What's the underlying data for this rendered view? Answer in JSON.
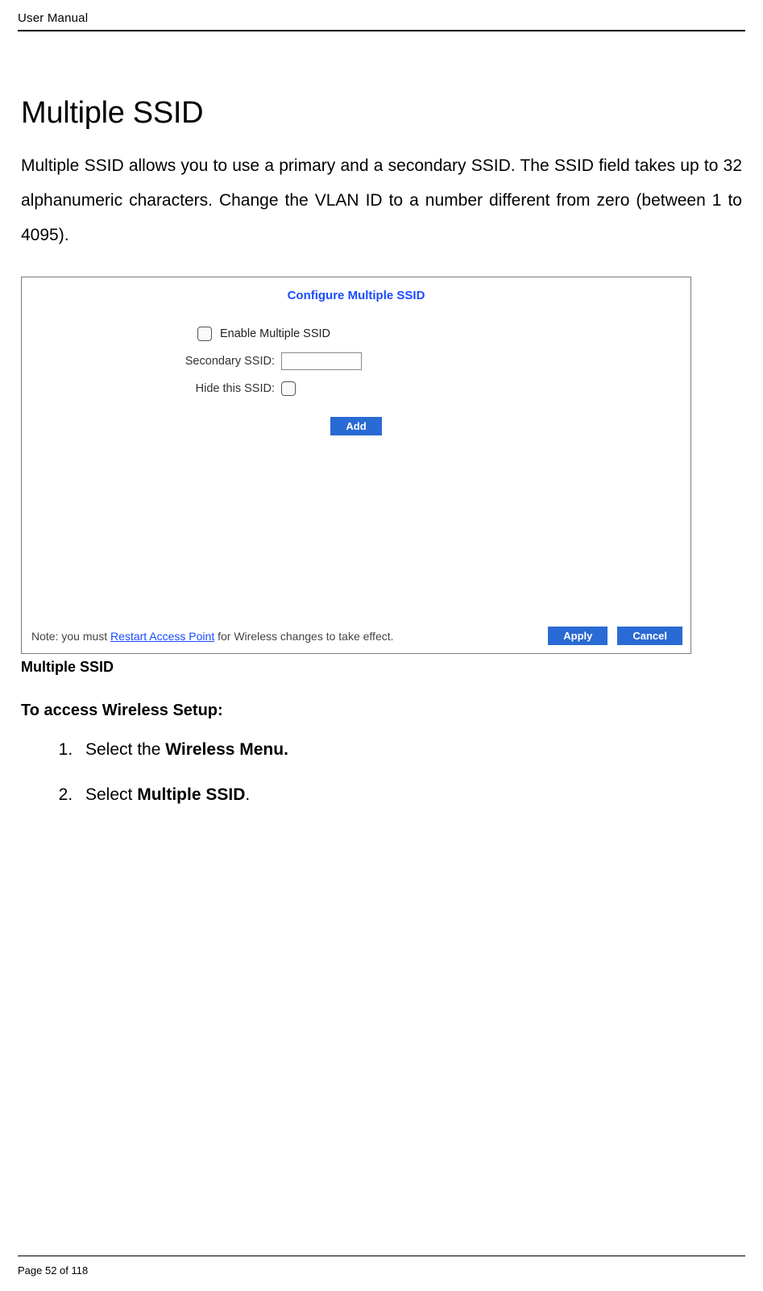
{
  "header": {
    "title": "User Manual"
  },
  "section": {
    "title": "Multiple SSID",
    "body": "Multiple SSID allows you to use a primary and a secondary SSID. The SSID field takes up to 32 alphanumeric characters. Change the VLAN ID to a number different from zero (between 1 to 4095)."
  },
  "screenshot": {
    "title": "Configure Multiple SSID",
    "enable_label": "Enable Multiple SSID",
    "secondary_label": "Secondary SSID:",
    "secondary_value": "",
    "hide_label": "Hide this SSID:",
    "add_label": "Add",
    "note_prefix": "Note: you must ",
    "note_link": "Restart Access Point",
    "note_suffix": " for Wireless changes to take effect.",
    "apply_label": "Apply",
    "cancel_label": "Cancel"
  },
  "caption": "Multiple SSID",
  "subheading": "To access Wireless Setup:",
  "steps": [
    {
      "prefix": "Select the ",
      "bold": "Wireless Menu.",
      "suffix": ""
    },
    {
      "prefix": "Select ",
      "bold": "Multiple SSID",
      "suffix": "."
    }
  ],
  "footer": {
    "page_label": "Page 52",
    "of_label": " of 118"
  }
}
